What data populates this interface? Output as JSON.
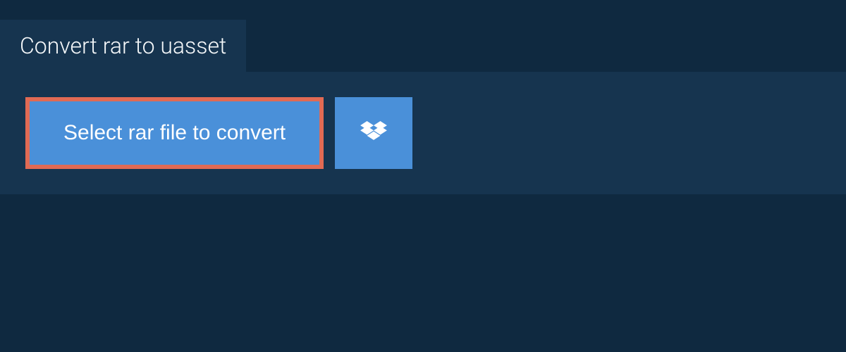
{
  "tab": {
    "title": "Convert rar to uasset"
  },
  "actions": {
    "select_file_label": "Select rar file to convert"
  }
}
